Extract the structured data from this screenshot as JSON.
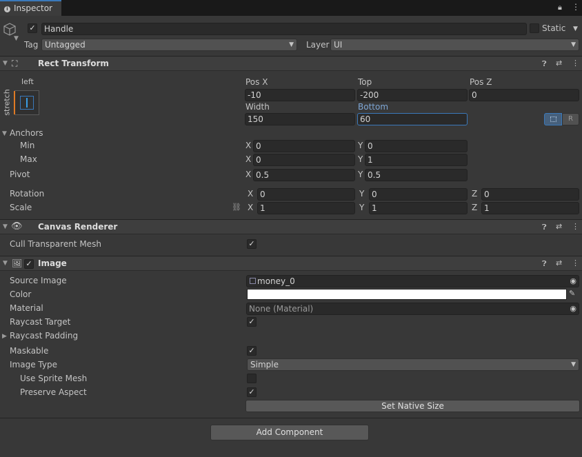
{
  "tab": {
    "title": "Inspector"
  },
  "gameobject": {
    "name": "Handle",
    "static_label": "Static",
    "tag_label": "Tag",
    "tag_value": "Untagged",
    "layer_label": "Layer",
    "layer_value": "UI"
  },
  "rect_transform": {
    "title": "Rect Transform",
    "anchor_preset_h": "left",
    "anchor_preset_v": "stretch",
    "pos_x_label": "Pos X",
    "pos_x": "-10",
    "top_label": "Top",
    "top": "-200",
    "pos_z_label": "Pos Z",
    "pos_z": "0",
    "width_label": "Width",
    "width": "150",
    "bottom_label": "Bottom",
    "bottom": "60",
    "raw_button": "R",
    "anchors_label": "Anchors",
    "min_label": "Min",
    "min_x": "0",
    "min_y": "0",
    "max_label": "Max",
    "max_x": "0",
    "max_y": "1",
    "pivot_label": "Pivot",
    "pivot_x": "0.5",
    "pivot_y": "0.5",
    "rotation_label": "Rotation",
    "rot_x": "0",
    "rot_y": "0",
    "rot_z": "0",
    "scale_label": "Scale",
    "scale_x": "1",
    "scale_y": "1",
    "scale_z": "1",
    "x": "X",
    "y": "Y",
    "z": "Z"
  },
  "canvas_renderer": {
    "title": "Canvas Renderer",
    "cull_label": "Cull Transparent Mesh"
  },
  "image": {
    "title": "Image",
    "source_label": "Source Image",
    "source_value": "money_0",
    "color_label": "Color",
    "material_label": "Material",
    "material_value": "None (Material)",
    "raycast_target_label": "Raycast Target",
    "raycast_padding_label": "Raycast Padding",
    "maskable_label": "Maskable",
    "image_type_label": "Image Type",
    "image_type_value": "Simple",
    "use_sprite_mesh_label": "Use Sprite Mesh",
    "preserve_aspect_label": "Preserve Aspect",
    "native_size_button": "Set Native Size"
  },
  "add_component_button": "Add Component",
  "colors": {
    "accent": "#3a79bb",
    "panel": "#383838",
    "header": "#3e3e3e",
    "field": "#2a2a2a"
  }
}
